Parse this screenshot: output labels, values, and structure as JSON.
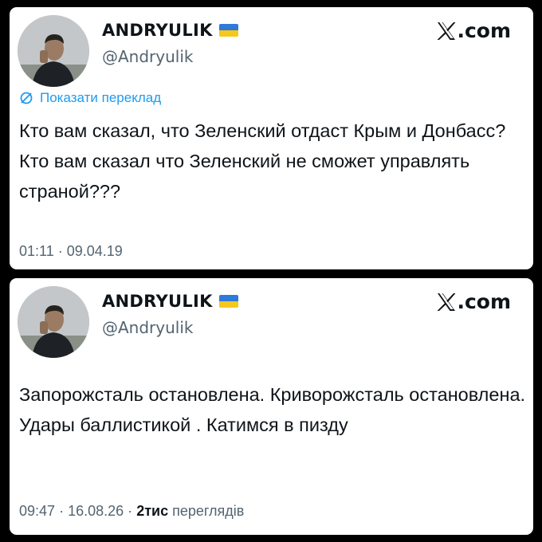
{
  "tweets": [
    {
      "author_name": "ANDRYULIK",
      "handle": "@Andryulik",
      "brand": ".com",
      "translate_label": "Показати переклад",
      "text": "Кто вам сказал, что Зеленский отдаст Крым и Донбасс? Кто вам сказал что Зеленский не сможет управлять страной???",
      "time": "01:11",
      "date": "09.04.19",
      "views_count": "",
      "views_label": ""
    },
    {
      "author_name": "ANDRYULIK",
      "handle": "@Andryulik",
      "brand": ".com",
      "text": "Запорожсталь остановлена. Криворожсталь остановлена. Удары баллистикой . Катимся в пизду",
      "time": "09:47",
      "date": "16.08.26",
      "views_count": "2тис",
      "views_label": "переглядів"
    }
  ],
  "separator": "·",
  "icons": [
    "avatar-photo",
    "ukraine-flag-icon",
    "x-logo-icon",
    "translate-icon"
  ],
  "colors": {
    "background": "#000000",
    "card": "#ffffff",
    "link_blue": "#1d9bf0",
    "muted_gray": "#536471",
    "flag_blue": "#2f79d8",
    "flag_yellow": "#f4c81d"
  }
}
